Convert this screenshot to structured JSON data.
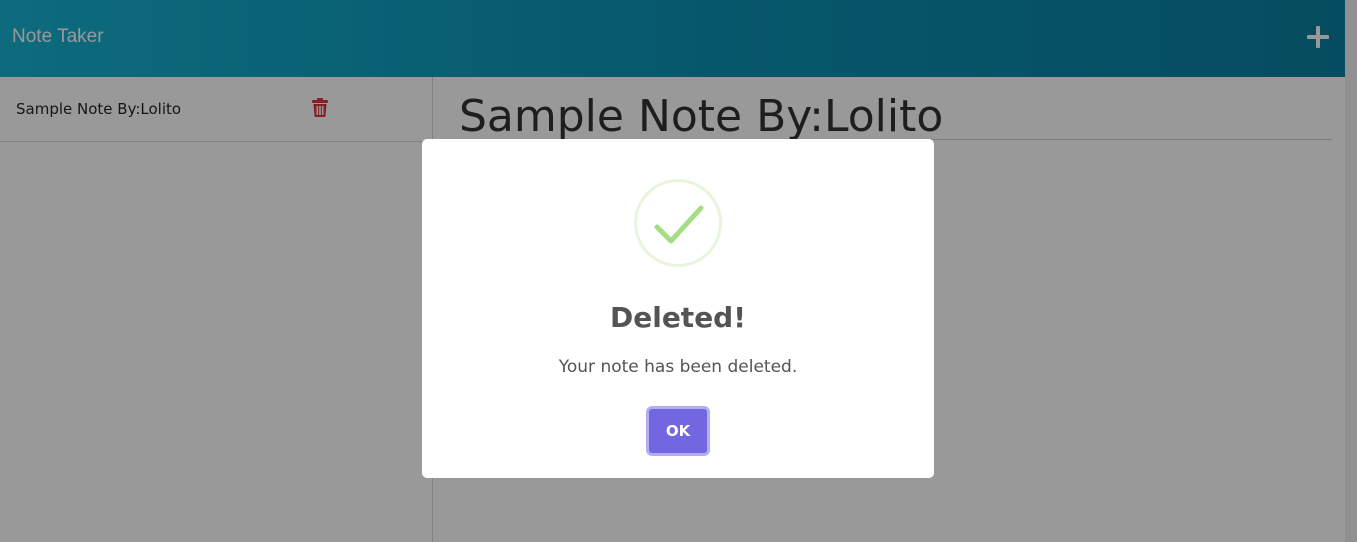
{
  "navbar": {
    "title": "Note Taker",
    "add_icon": "plus-icon",
    "color_start": "#16b3d1",
    "color_end": "#0a7fa0"
  },
  "sidebar": {
    "notes": [
      {
        "title": "Sample Note By:Lolito",
        "delete_icon": "trash-icon",
        "delete_color": "#dc3545"
      }
    ]
  },
  "main": {
    "note_title": "Sample Note By:Lolito"
  },
  "dialog": {
    "icon": "success-check-icon",
    "icon_color": "#a5dc86",
    "title": "Deleted!",
    "text": "Your note has been deleted.",
    "ok_label": "OK",
    "ok_color": "#7267e0"
  }
}
